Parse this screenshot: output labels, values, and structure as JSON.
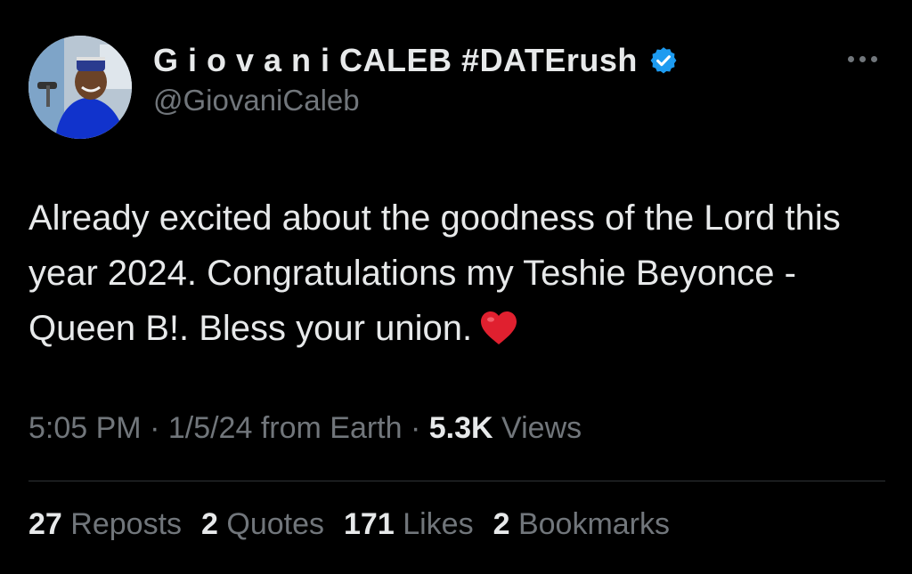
{
  "author": {
    "display_name": "G i o v a n i CALEB #DATErush",
    "handle": "@GiovaniCaleb",
    "verified_icon": "verified-badge-icon",
    "badge_color": "#1d9bf0"
  },
  "tweet": {
    "text": "Already excited about the goodness of the Lord this year 2024. Congratulations my Teshie Beyonce - Queen B!. Bless your union.",
    "emoji_icon": "red-heart-icon"
  },
  "meta": {
    "time": "5:05 PM",
    "sep1": " · ",
    "date": "1/5/24",
    "source": " from Earth",
    "sep2": " · ",
    "views_count": "5.3K",
    "views_label": " Views"
  },
  "stats": [
    {
      "count": "27",
      "label": "Reposts"
    },
    {
      "count": "2",
      "label": "Quotes"
    },
    {
      "count": "171",
      "label": "Likes"
    },
    {
      "count": "2",
      "label": "Bookmarks"
    }
  ],
  "colors": {
    "background": "#000000",
    "text": "#e7e9ea",
    "muted": "#71767b",
    "divider": "#2f3336"
  }
}
